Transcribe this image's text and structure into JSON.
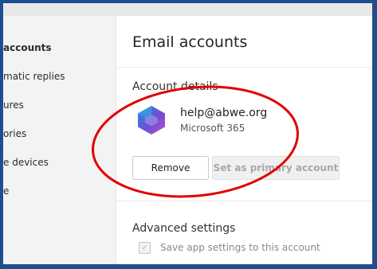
{
  "sidebar": {
    "items": [
      {
        "label": "accounts",
        "active": true
      },
      {
        "label": "matic replies"
      },
      {
        "label": "ures"
      },
      {
        "label": "ories"
      },
      {
        "label": "e devices"
      },
      {
        "label": "e"
      }
    ]
  },
  "main": {
    "title": "Email accounts",
    "account_section_title": "Account details",
    "account": {
      "email": "help@abwe.org",
      "type": "Microsoft 365",
      "logo_icon": "microsoft-365-logo-icon"
    },
    "buttons": {
      "remove_label": "Remove",
      "set_primary_label": "Set as primary account"
    },
    "advanced": {
      "title": "Advanced settings",
      "save_settings_label": "Save app settings to this account",
      "save_settings_checked": true,
      "save_settings_enabled": false
    }
  },
  "colors": {
    "frame_border": "#1f4e8c",
    "annotation_circle": "#e00000",
    "logo_gradient": [
      "#2a8cd8",
      "#6c4fd6",
      "#c04bd0"
    ]
  }
}
